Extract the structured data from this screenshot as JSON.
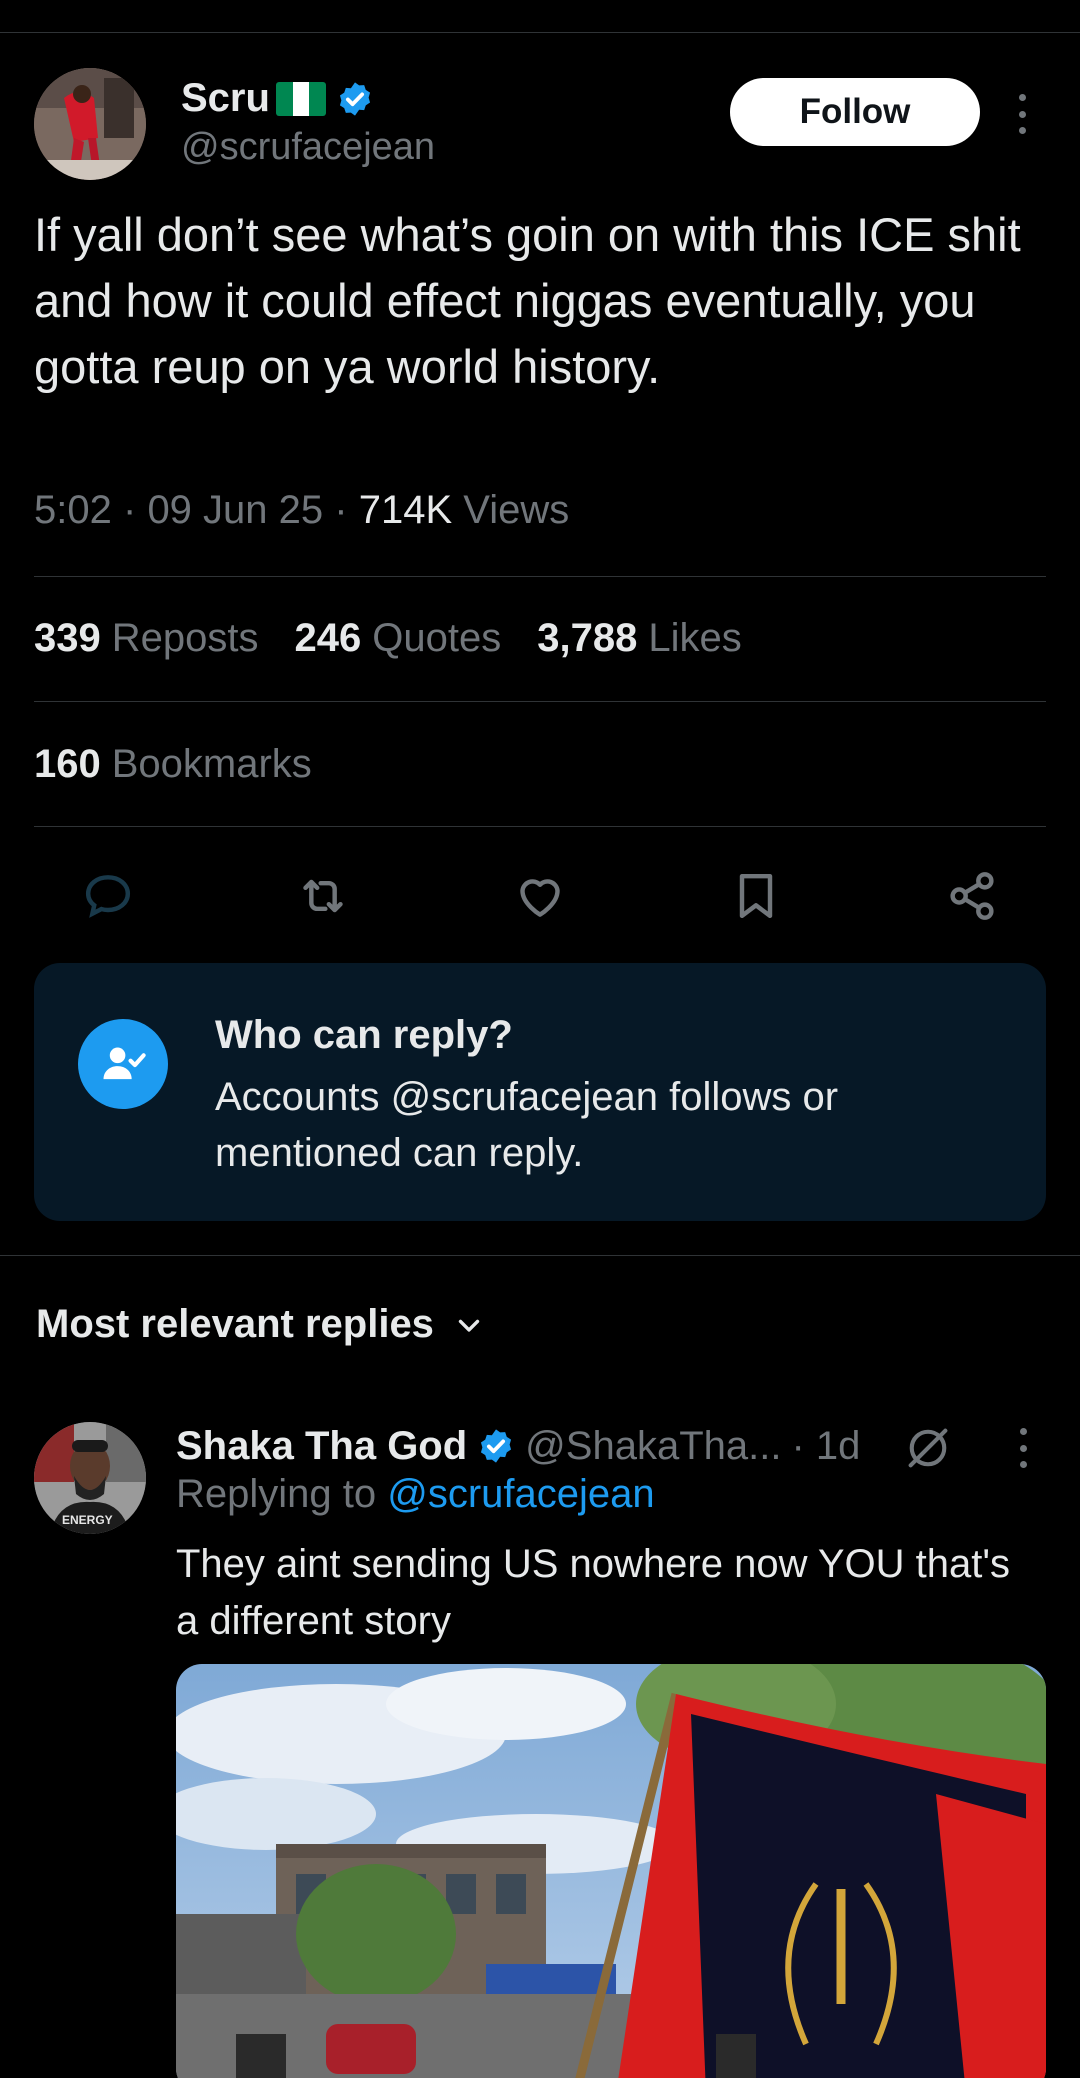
{
  "post": {
    "author_name": "Scru",
    "author_handle": "@scrufacejean",
    "follow_label": "Follow",
    "text": "If yall don’t see what’s goin on with this ICE shit and how it could effect niggas eventually, you gotta reup on ya world history.",
    "time": "5:02",
    "date": "09 Jun 25",
    "views_count": "714K",
    "views_label": "Views",
    "sep": "·"
  },
  "stats": {
    "reposts_count": "339",
    "reposts_label": "Reposts",
    "quotes_count": "246",
    "quotes_label": "Quotes",
    "likes_count": "3,788",
    "likes_label": "Likes",
    "bookmarks_count": "160",
    "bookmarks_label": "Bookmarks"
  },
  "actions": [
    "reply-icon",
    "repost-icon",
    "like-icon",
    "bookmark-icon",
    "share-icon"
  ],
  "reply_restriction": {
    "title": "Who can reply?",
    "description": "Accounts @scrufacejean follows or mentioned can reply."
  },
  "replies_section": {
    "sort_label": "Most relevant replies"
  },
  "reply": {
    "author_name": "Shaka Tha God",
    "author_handle": "@ShakaTha...",
    "time": "· 1d",
    "replying_prefix": "Replying to",
    "replying_handle": "@scrufacejean",
    "text": "They aint sending US nowhere now YOU that's a different story",
    "avatar_text": "ENERGY"
  },
  "colors": {
    "background": "#000000",
    "text_primary": "#e7e9ea",
    "text_secondary": "#71767b",
    "accent": "#1d9bf0",
    "divider": "#2f3336",
    "reply_box": "#061826"
  }
}
